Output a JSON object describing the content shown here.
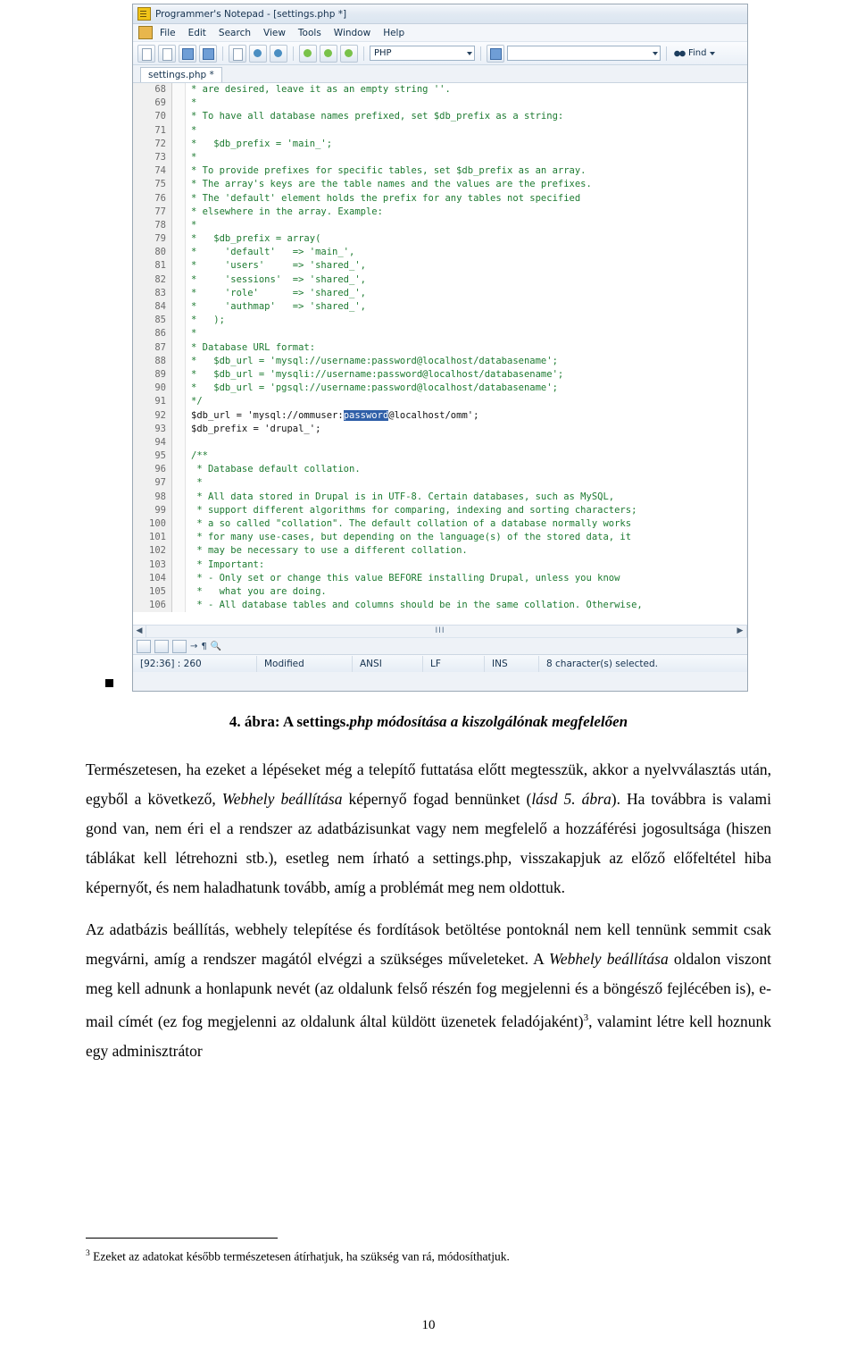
{
  "screenshot": {
    "titlebar": {
      "title": "Programmer's Notepad - [settings.php *]",
      "icon": "notepad-icon"
    },
    "menu": [
      "File",
      "Edit",
      "Search",
      "View",
      "Tools",
      "Window",
      "Help"
    ],
    "toolbar": {
      "language_combo": "PHP",
      "wide_combo": "",
      "find_label": "Find"
    },
    "tab": "settings.php *",
    "scroll_marker": "III",
    "statusbar": {
      "position": "[92:36] : 260",
      "modified": "Modified",
      "encoding": "ANSI",
      "eol": "LF",
      "insert": "INS",
      "selection": "8 character(s) selected."
    },
    "code_lines": [
      {
        "n": "68",
        "text": "* are desired, leave it as an empty string ''.",
        "type": "comment"
      },
      {
        "n": "69",
        "text": "*",
        "type": "comment"
      },
      {
        "n": "70",
        "text": "* To have all database names prefixed, set $db_prefix as a string:",
        "type": "comment"
      },
      {
        "n": "71",
        "text": "*",
        "type": "comment"
      },
      {
        "n": "72",
        "text": "*   $db_prefix = 'main_';",
        "type": "comment"
      },
      {
        "n": "73",
        "text": "*",
        "type": "comment"
      },
      {
        "n": "74",
        "text": "* To provide prefixes for specific tables, set $db_prefix as an array.",
        "type": "comment"
      },
      {
        "n": "75",
        "text": "* The array's keys are the table names and the values are the prefixes.",
        "type": "comment"
      },
      {
        "n": "76",
        "text": "* The 'default' element holds the prefix for any tables not specified",
        "type": "comment"
      },
      {
        "n": "77",
        "text": "* elsewhere in the array. Example:",
        "type": "comment"
      },
      {
        "n": "78",
        "text": "*",
        "type": "comment"
      },
      {
        "n": "79",
        "text": "*   $db_prefix = array(",
        "type": "comment"
      },
      {
        "n": "80",
        "text": "*     'default'   => 'main_',",
        "type": "comment"
      },
      {
        "n": "81",
        "text": "*     'users'     => 'shared_',",
        "type": "comment"
      },
      {
        "n": "82",
        "text": "*     'sessions'  => 'shared_',",
        "type": "comment"
      },
      {
        "n": "83",
        "text": "*     'role'      => 'shared_',",
        "type": "comment"
      },
      {
        "n": "84",
        "text": "*     'authmap'   => 'shared_',",
        "type": "comment"
      },
      {
        "n": "85",
        "text": "*   );",
        "type": "comment"
      },
      {
        "n": "86",
        "text": "*",
        "type": "comment"
      },
      {
        "n": "87",
        "text": "* Database URL format:",
        "type": "comment"
      },
      {
        "n": "88",
        "text": "*   $db_url = 'mysql://username:password@localhost/databasename';",
        "type": "comment"
      },
      {
        "n": "89",
        "text": "*   $db_url = 'mysqli://username:password@localhost/databasename';",
        "type": "comment"
      },
      {
        "n": "90",
        "text": "*   $db_url = 'pgsql://username:password@localhost/databasename';",
        "type": "comment"
      },
      {
        "n": "91",
        "text": "*/",
        "type": "comment"
      },
      {
        "n": "92",
        "text": "",
        "type": "selection"
      },
      {
        "n": "93",
        "text": "$db_prefix = 'drupal_';",
        "type": "code"
      },
      {
        "n": "94",
        "text": "",
        "type": "code"
      },
      {
        "n": "95",
        "text": "/**",
        "type": "comment"
      },
      {
        "n": "96",
        "text": " * Database default collation.",
        "type": "comment"
      },
      {
        "n": "97",
        "text": " *",
        "type": "comment"
      },
      {
        "n": "98",
        "text": " * All data stored in Drupal is in UTF-8. Certain databases, such as MySQL,",
        "type": "comment"
      },
      {
        "n": "99",
        "text": " * support different algorithms for comparing, indexing and sorting characters;",
        "type": "comment"
      },
      {
        "n": "100",
        "text": " * a so called \"collation\". The default collation of a database normally works",
        "type": "comment"
      },
      {
        "n": "101",
        "text": " * for many use-cases, but depending on the language(s) of the stored data, it",
        "type": "comment"
      },
      {
        "n": "102",
        "text": " * may be necessary to use a different collation.",
        "type": "comment"
      },
      {
        "n": "103",
        "text": " * Important:",
        "type": "comment"
      },
      {
        "n": "104",
        "text": " * - Only set or change this value BEFORE installing Drupal, unless you know",
        "type": "comment"
      },
      {
        "n": "105",
        "text": " *   what you are doing.",
        "type": "comment"
      },
      {
        "n": "106",
        "text": " * - All database tables and columns should be in the same collation. Otherwise,",
        "type": "comment"
      }
    ],
    "selected_line": {
      "prefix": "$db_url = 'mysql://ommuser:",
      "selection": "password",
      "suffix": "@localhost/omm';"
    }
  },
  "document": {
    "caption": {
      "prefix": "4. ábra: A settings.",
      "emphasis": "php módosítása a kiszolgálónak megfelelően"
    },
    "paragraphs": [
      {
        "id": "p1",
        "html": "Természetesen, ha ezeket a lépéseket még a telepítő futtatása előtt megtesszük, akkor a nyelvválasztás után, egyből a következő, <i>Webhely beállítása</i> képernyő fogad bennünket (<i>lásd 5. ábra</i>). Ha továbbra is valami gond van, nem éri el a rendszer az adatbázisunkat vagy nem megfelelő a hozzáférési jogosultsága (hiszen táblákat kell létrehozni stb.), esetleg nem írható a settings.php, visszakapjuk az előző előfeltétel hiba képernyőt, és nem haladhatunk tovább, amíg a problémát meg nem oldottuk."
      },
      {
        "id": "p2",
        "html": "Az adatbázis beállítás, webhely telepítése és fordítások betöltése pontoknál nem kell tennünk semmit csak megvárni, amíg a rendszer magától elvégzi a szükséges műveleteket. A <i>Webhely beállítása</i> oldalon viszont meg kell adnunk a honlapunk nevét (az oldalunk felső részén fog megjelenni és a böngésző fejlécében is), e-mail címét (ez fog megjelenni az oldalunk által küldött üzenetek feladójaként)<sup>3</sup>, valamint létre kell hoznunk egy adminisztrátor"
      }
    ],
    "footnote": {
      "marker": "3",
      "text": "Ezeket az adatokat később természetesen átírhatjuk, ha szükség van rá, módosíthatjuk."
    },
    "page_number": "10"
  }
}
